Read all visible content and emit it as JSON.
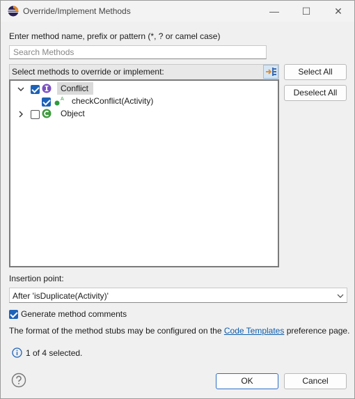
{
  "window": {
    "title": "Override/Implement Methods",
    "minimize_glyph": "—",
    "maximize_glyph": "☐",
    "close_glyph": "✕"
  },
  "filter": {
    "label": "Enter method name, prefix or pattern (*, ? or camel case)",
    "placeholder": "Search Methods"
  },
  "tree": {
    "header": "Select methods to override or implement:",
    "items": [
      {
        "label": "Conflict",
        "checked": true,
        "expanded": true,
        "kind": "interface"
      },
      {
        "label": "checkConflict(Activity)",
        "checked": true,
        "kind": "abstract-method",
        "badge": "A"
      },
      {
        "label": "Object",
        "checked": false,
        "expanded": false,
        "kind": "class"
      }
    ]
  },
  "buttons": {
    "select_all": "Select All",
    "deselect_all": "Deselect All",
    "ok": "OK",
    "cancel": "Cancel"
  },
  "insertion": {
    "label": "Insertion point:",
    "value": "After 'isDuplicate(Activity)'"
  },
  "generate_comments": {
    "label": "Generate method comments",
    "checked": true
  },
  "info": {
    "prefix": "The format of the method stubs may be configured on the",
    "link": "Code Templates",
    "suffix": "preference page."
  },
  "status": {
    "text": "1 of 4 selected."
  },
  "colors": {
    "accent": "#1d62b8",
    "interface_icon": "#7a4fc2",
    "class_icon": "#3f9b3f",
    "method_dot": "#2e9b3e",
    "link": "#0b5cad"
  }
}
